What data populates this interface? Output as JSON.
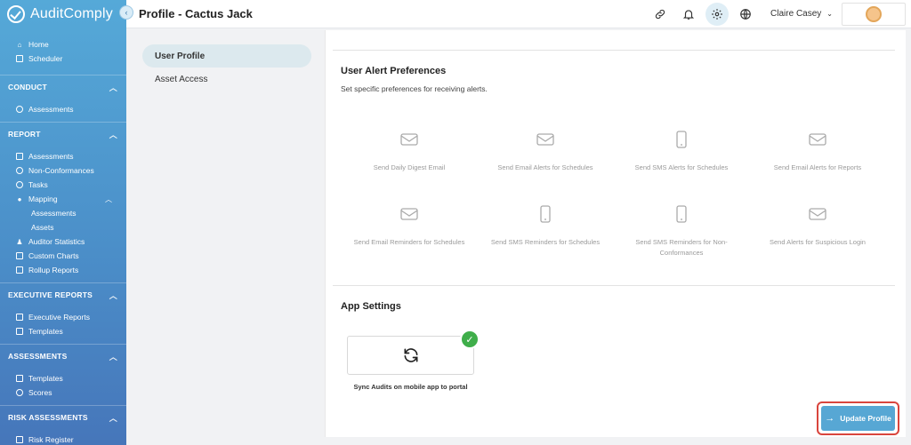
{
  "app": {
    "name": "AuditComply"
  },
  "header": {
    "title": "Profile - Cactus Jack",
    "user_name": "Claire Casey"
  },
  "sidebar": {
    "top_items": [
      {
        "label": "Home",
        "icon": "home-icon"
      },
      {
        "label": "Scheduler",
        "icon": "calendar-icon"
      }
    ],
    "sections": [
      {
        "title": "CONDUCT",
        "items": [
          {
            "label": "Assessments",
            "icon": "clock-icon"
          }
        ]
      },
      {
        "title": "REPORT",
        "items": [
          {
            "label": "Assessments",
            "icon": "table-icon"
          },
          {
            "label": "Non-Conformances",
            "icon": "search-icon"
          },
          {
            "label": "Tasks",
            "icon": "tasks-icon"
          },
          {
            "label": "Mapping",
            "icon": "pin-icon"
          },
          {
            "label": "Assessments",
            "icon": ""
          },
          {
            "label": "Assets",
            "icon": ""
          },
          {
            "label": "Auditor Statistics",
            "icon": "users-icon"
          },
          {
            "label": "Custom Charts",
            "icon": "chart-icon"
          },
          {
            "label": "Rollup Reports",
            "icon": "chart-icon"
          }
        ]
      },
      {
        "title": "EXECUTIVE REPORTS",
        "items": [
          {
            "label": "Executive Reports",
            "icon": "table-icon"
          },
          {
            "label": "Templates",
            "icon": "edit-icon"
          }
        ]
      },
      {
        "title": "ASSESSMENTS",
        "items": [
          {
            "label": "Templates",
            "icon": "table-icon"
          },
          {
            "label": "Scores",
            "icon": "award-icon"
          }
        ]
      },
      {
        "title": "RISK ASSESSMENTS",
        "items": [
          {
            "label": "Risk Register",
            "icon": "table-icon"
          }
        ]
      }
    ]
  },
  "tabs": [
    "User Profile",
    "Asset Access"
  ],
  "alerts": {
    "title": "User Alert Preferences",
    "subtitle": "Set specific preferences for receiving alerts.",
    "items": [
      {
        "label": "Send Daily Digest Email",
        "icon": "envelope-icon"
      },
      {
        "label": "Send Email Alerts for Schedules",
        "icon": "envelope-icon"
      },
      {
        "label": "Send SMS Alerts for Schedules",
        "icon": "phone-icon"
      },
      {
        "label": "Send Email Alerts for Reports",
        "icon": "envelope-icon"
      },
      {
        "label": "Send Email Reminders for Schedules",
        "icon": "envelope-icon"
      },
      {
        "label": "Send SMS Reminders for Schedules",
        "icon": "phone-icon"
      },
      {
        "label": "Send SMS Reminders for Non-Conformances",
        "icon": "phone-icon"
      },
      {
        "label": "Send Alerts for Suspicious Login",
        "icon": "envelope-icon"
      }
    ]
  },
  "app_settings": {
    "title": "App Settings",
    "sync_label": "Sync Audits on mobile app to portal",
    "sync_enabled": true
  },
  "actions": {
    "update_label": "Update Profile"
  },
  "colors": {
    "accent": "#57a7d4",
    "success": "#3fae4a",
    "highlight": "#d9453d"
  }
}
